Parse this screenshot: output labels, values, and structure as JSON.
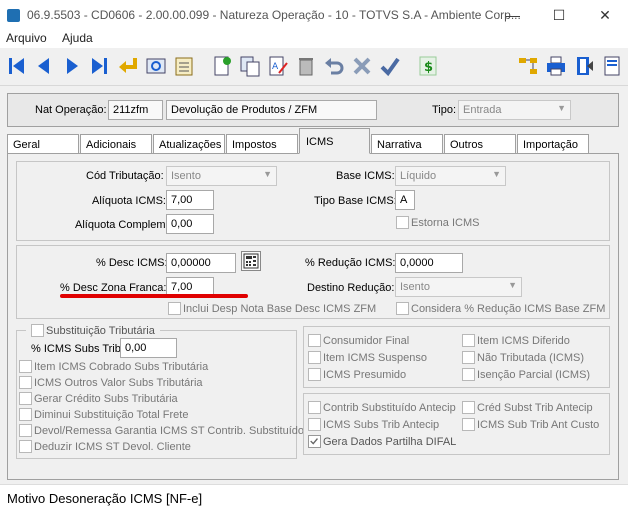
{
  "window": {
    "title": "06.9.5503 - CD0606 - 2.00.00.099 - Natureza Operação - 10 - TOTVS S.A - Ambiente Corp...",
    "minimize": "—",
    "maximize": "☐",
    "close": "✕"
  },
  "menu": [
    "Arquivo",
    "Ajuda"
  ],
  "header": {
    "nat_label": "Nat Operação:",
    "nat_code": "211zfm",
    "nat_desc": "Devolução de Produtos / ZFM",
    "tipo_label": "Tipo:",
    "tipo_value": "Entrada"
  },
  "tabs": [
    "Geral",
    "Adicionais",
    "Atualizações",
    "Impostos",
    "ICMS",
    "Narrativa",
    "Outros",
    "Importação"
  ],
  "icms": {
    "cod_trib_label": "Cód Tributação:",
    "cod_trib_value": "Isento",
    "aliquota_label": "Alíquota ICMS:",
    "aliquota_value": "7,00",
    "aliquota_compl_label": "Alíquota Complem:",
    "aliquota_compl_value": "0,00",
    "base_label": "Base ICMS:",
    "base_value": "Líquido",
    "tipo_base_label": "Tipo Base ICMS:",
    "tipo_base_value": "A",
    "estorna_label": "Estorna ICMS",
    "desc_label": "% Desc ICMS:",
    "desc_value": "0,00000",
    "desc_zf_label": "% Desc Zona Franca:",
    "desc_zf_value": "7,00",
    "reducao_label": "% Redução ICMS:",
    "reducao_value": "0,0000",
    "destino_label": "Destino Redução:",
    "destino_value": "Isento",
    "inclui_desp_label": "Inclui Desp Nota Base Desc ICMS ZFM",
    "considera_label": "Considera % Redução ICMS Base ZFM"
  },
  "subst": {
    "title": "Substituição Tributária",
    "perc_label": "% ICMS Subs Trib:",
    "perc_value": "0,00",
    "options": [
      "Item ICMS Cobrado Subs Tributária",
      "ICMS Outros Valor Subs Tributária",
      "Gerar Crédito Subs Tributária",
      "Diminui Substituição Total Frete",
      "Devol/Remessa Garantia ICMS ST Contrib. Substituído",
      "Deduzir ICMS ST Devol. Cliente"
    ]
  },
  "right_group1": {
    "col1": [
      "Consumidor Final",
      "Item ICMS Suspenso",
      "ICMS Presumido"
    ],
    "col2": [
      "Item ICMS Diferido",
      "Não Tributada (ICMS)",
      "Isenção Parcial (ICMS)"
    ]
  },
  "right_group2": {
    "col1": [
      "Contrib Substituído Antecip",
      "ICMS Subs Trib Antecip",
      "Gera Dados Partilha DIFAL"
    ],
    "col2": [
      "Créd Subst Trib Antecip",
      "ICMS Sub Trib Ant Custo"
    ],
    "gera_difal_checked": true
  },
  "status": "Motivo Desoneração ICMS [NF-e]",
  "colors": {
    "highlight_underline": "#e00000",
    "toolbar_blue": "#1a5fd0"
  }
}
